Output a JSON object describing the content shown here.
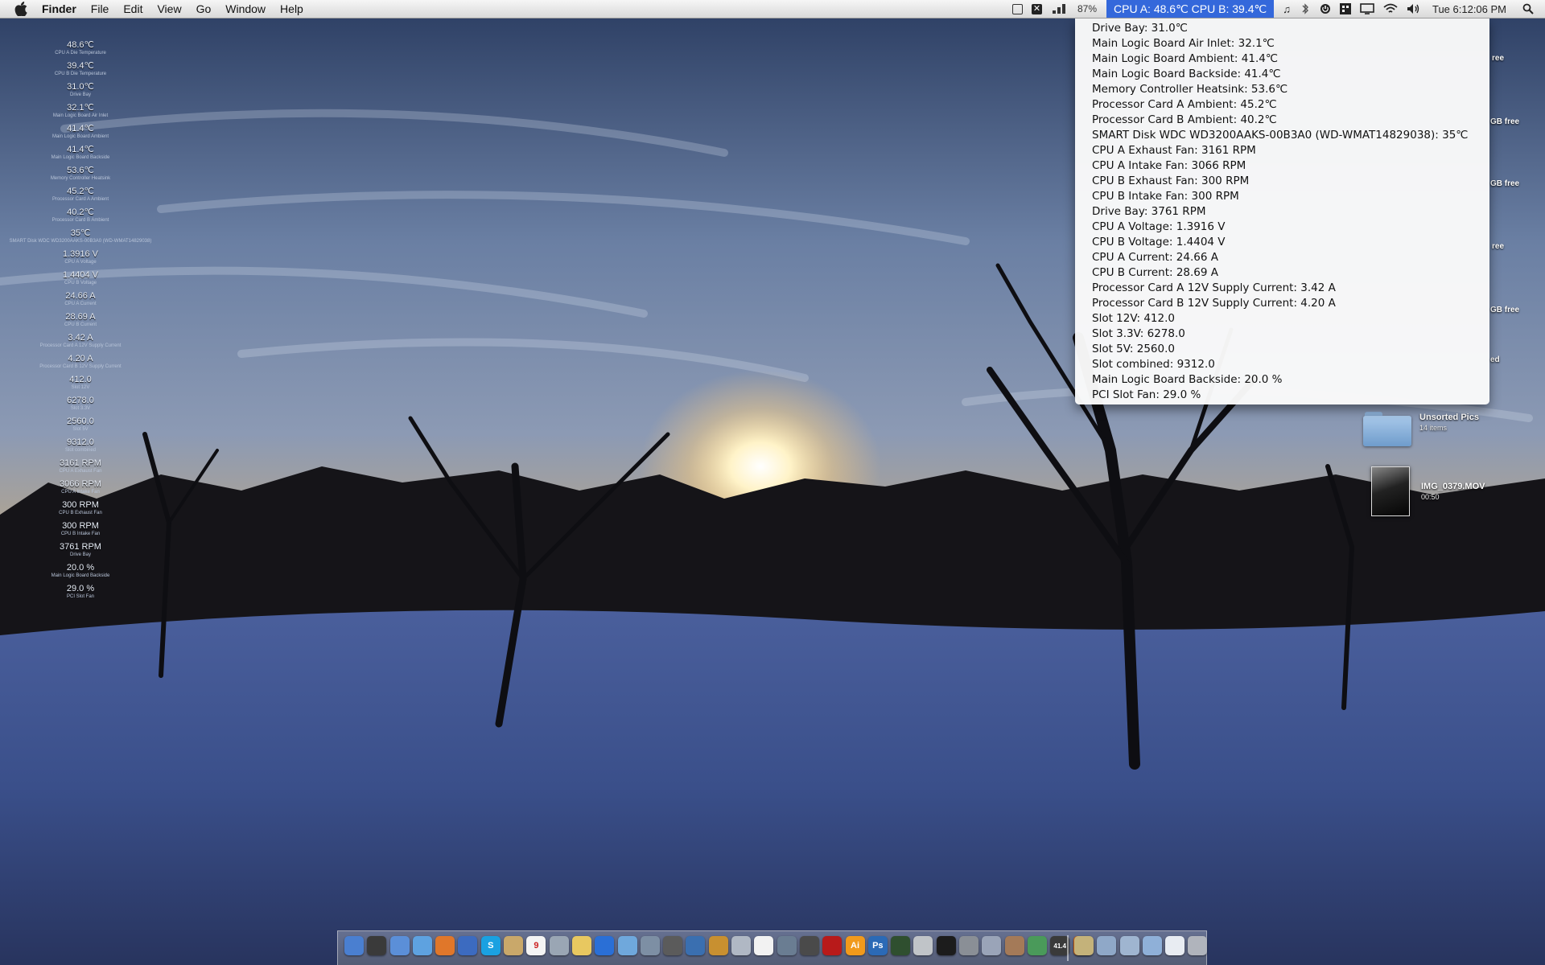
{
  "menubar": {
    "apple_icon": "apple-icon",
    "app_name": "Finder",
    "menus": [
      "File",
      "Edit",
      "View",
      "Go",
      "Window",
      "Help"
    ],
    "status_icons": [
      "screen-icon",
      "x-icon",
      "wifi-signal-icon"
    ],
    "battery_percent": "87%",
    "temperature_menu": "CPU A: 48.6℃ CPU B: 39.4℃",
    "right_icons": [
      "music-note-icon",
      "bluetooth-icon",
      "power-icon",
      "spaces-icon",
      "display-icon",
      "wifi-icon",
      "volume-icon"
    ],
    "clock": "Tue 6:12:06 PM",
    "spotlight_icon": "spotlight-icon"
  },
  "dropdown": {
    "items": [
      "Drive Bay: 31.0℃",
      "Main Logic Board Air Inlet: 32.1℃",
      "Main Logic Board Ambient: 41.4℃",
      "Main Logic Board Backside: 41.4℃",
      "Memory Controller Heatsink: 53.6℃",
      "Processor Card A Ambient: 45.2℃",
      "Processor Card B Ambient: 40.2℃",
      "SMART Disk WDC WD3200AAKS-00B3A0 (WD-WMAT14829038): 35℃",
      "CPU A Exhaust Fan: 3161 RPM",
      "CPU A Intake Fan: 3066 RPM",
      "CPU B Exhaust Fan: 300 RPM",
      "CPU B Intake Fan: 300 RPM",
      "Drive Bay: 3761 RPM",
      "CPU A Voltage: 1.3916 V",
      "CPU B Voltage: 1.4404 V",
      "CPU A Current: 24.66 A",
      "CPU B Current: 28.69 A",
      "Processor Card A 12V Supply Current: 3.42 A",
      "Processor Card B 12V Supply Current: 4.20 A",
      "Slot 12V: 412.0",
      "Slot 3.3V: 6278.0",
      "Slot 5V: 2560.0",
      "Slot combined: 9312.0",
      "Main Logic Board Backside: 20.0 %",
      "PCI Slot Fan: 29.0 %"
    ]
  },
  "sensors": [
    {
      "value": "48.6℃",
      "label": "CPU A Die Temperature"
    },
    {
      "value": "39.4℃",
      "label": "CPU B Die Temperature"
    },
    {
      "value": "31.0℃",
      "label": "Drive Bay"
    },
    {
      "value": "32.1℃",
      "label": "Main Logic Board Air Inlet"
    },
    {
      "value": "41.4℃",
      "label": "Main Logic Board Ambient"
    },
    {
      "value": "41.4℃",
      "label": "Main Logic Board Backside"
    },
    {
      "value": "53.6℃",
      "label": "Memory Controller Heatsink"
    },
    {
      "value": "45.2℃",
      "label": "Processor Card A Ambient"
    },
    {
      "value": "40.2℃",
      "label": "Processor Card B Ambient"
    },
    {
      "value": "35℃",
      "label": "SMART Disk WDC WD3200AAKS-00B3A0 (WD-WMAT14829038)"
    },
    {
      "value": "1.3916 V",
      "label": "CPU A Voltage"
    },
    {
      "value": "1.4404 V",
      "label": "CPU B Voltage"
    },
    {
      "value": "24.66 A",
      "label": "CPU A Current"
    },
    {
      "value": "28.69 A",
      "label": "CPU B Current"
    },
    {
      "value": "3.42 A",
      "label": "Processor Card A 12V Supply Current"
    },
    {
      "value": "4.20 A",
      "label": "Processor Card B 12V Supply Current"
    },
    {
      "value": "412.0",
      "label": "Slot 12V"
    },
    {
      "value": "6278.0",
      "label": "Slot 3.3V"
    },
    {
      "value": "2560.0",
      "label": "Slot 5V"
    },
    {
      "value": "9312.0",
      "label": "Slot combined"
    },
    {
      "value": "3161 RPM",
      "label": "CPU A Exhaust Fan"
    },
    {
      "value": "3066 RPM",
      "label": "CPU A Intake Fan"
    },
    {
      "value": "300 RPM",
      "label": "CPU B Exhaust Fan"
    },
    {
      "value": "300 RPM",
      "label": "CPU B Intake Fan"
    },
    {
      "value": "3761 RPM",
      "label": "Drive Bay"
    },
    {
      "value": "20.0 %",
      "label": "Main Logic Board Backside"
    },
    {
      "value": "29.0 %",
      "label": "PCI Slot Fan"
    }
  ],
  "desktop": {
    "partial_labels": [
      "ree",
      "GB free",
      "GB free",
      "ree",
      "GB free",
      "ed"
    ],
    "items": [
      {
        "name": "Unsorted Pics",
        "sub": "14 items",
        "icon": "folder-icon"
      },
      {
        "name": "IMG_0379.MOV",
        "sub": "00:50",
        "icon": "movie-icon"
      }
    ]
  },
  "dock": {
    "apps": [
      {
        "icon": "finder-icon",
        "color": "#4a7fd0",
        "glyph": ""
      },
      {
        "icon": "dashboard-icon",
        "color": "#3a3a3a",
        "glyph": ""
      },
      {
        "icon": "mail-icon",
        "color": "#5b8fd8",
        "glyph": ""
      },
      {
        "icon": "safari-icon",
        "color": "#5ea2e0",
        "glyph": ""
      },
      {
        "icon": "firefox-icon",
        "color": "#e0772a",
        "glyph": ""
      },
      {
        "icon": "ichat-icon",
        "color": "#3c6bc0",
        "glyph": ""
      },
      {
        "icon": "skype-icon",
        "color": "#1aa1e1",
        "glyph": "S"
      },
      {
        "icon": "address-book-icon",
        "color": "#c9a86a",
        "glyph": ""
      },
      {
        "icon": "ical-icon",
        "color": "#f4f4f4",
        "glyph": "9"
      },
      {
        "icon": "preview-icon",
        "color": "#9aa6b4",
        "glyph": ""
      },
      {
        "icon": "stamps-icon",
        "color": "#e8c860",
        "glyph": ""
      },
      {
        "icon": "quicktime-icon",
        "color": "#2a6fd6",
        "glyph": ""
      },
      {
        "icon": "itunes-icon",
        "color": "#6fa8dc",
        "glyph": ""
      },
      {
        "icon": "iphoto-icon",
        "color": "#7d8fa4",
        "glyph": ""
      },
      {
        "icon": "imovie-icon",
        "color": "#5b5b5b",
        "glyph": ""
      },
      {
        "icon": "dvd-icon",
        "color": "#3a6fb0",
        "glyph": ""
      },
      {
        "icon": "garageband-icon",
        "color": "#c89030",
        "glyph": ""
      },
      {
        "icon": "iweb-icon",
        "color": "#b0b8c4",
        "glyph": ""
      },
      {
        "icon": "textedit-icon",
        "color": "#f2f2f2",
        "glyph": ""
      },
      {
        "icon": "xcode-icon",
        "color": "#6a7d92",
        "glyph": ""
      },
      {
        "icon": "final-cut-icon",
        "color": "#4a4a4a",
        "glyph": ""
      },
      {
        "icon": "acrobat-icon",
        "color": "#b81a1a",
        "glyph": ""
      },
      {
        "icon": "illustrator-icon",
        "color": "#f19a1b",
        "glyph": "Ai"
      },
      {
        "icon": "photoshop-icon",
        "color": "#2b6ab6",
        "glyph": "Ps"
      },
      {
        "icon": "activity-monitor-icon",
        "color": "#2f4f2f",
        "glyph": ""
      },
      {
        "icon": "printer-icon",
        "color": "#c0c4c8",
        "glyph": ""
      },
      {
        "icon": "terminal-icon",
        "color": "#1c1c1c",
        "glyph": ""
      },
      {
        "icon": "system-prefs-icon",
        "color": "#8a8f96",
        "glyph": ""
      },
      {
        "icon": "script-editor-icon",
        "color": "#9aa4b8",
        "glyph": ""
      },
      {
        "icon": "automator-icon",
        "color": "#a47a58",
        "glyph": ""
      },
      {
        "icon": "numbers-icon",
        "color": "#4a9a5a",
        "glyph": ""
      },
      {
        "icon": "temperature-monitor-icon",
        "color": "#3a3a3a",
        "glyph": "41.4"
      },
      {
        "icon": "instruments-icon",
        "color": "#e06a14",
        "glyph": ""
      }
    ],
    "stacks": [
      {
        "icon": "applications-stack-icon",
        "color": "#c4b27a"
      },
      {
        "icon": "documents-stack-icon",
        "color": "#8fa8c8"
      },
      {
        "icon": "downloads-stack-icon",
        "color": "#9fb5d0"
      },
      {
        "icon": "folder-stack-icon",
        "color": "#8fb0d8"
      },
      {
        "icon": "mail-stack-icon",
        "color": "#e8ecf2"
      },
      {
        "icon": "trash-icon",
        "color": "#b0b4bc"
      }
    ]
  }
}
